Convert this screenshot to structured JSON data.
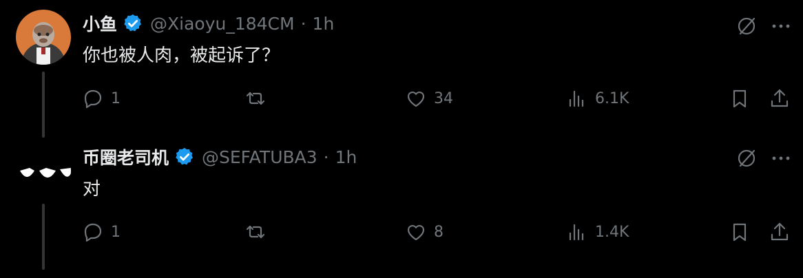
{
  "tweets": [
    {
      "display_name": "小鱼",
      "handle": "@Xiaoyu_184CM",
      "separator": "·",
      "time": "1h",
      "text": "你也被人肉，被起诉了？",
      "verified": true,
      "avatar_icon": "cartoon-character-avatar",
      "stats": {
        "replies": "1",
        "retweets": "",
        "likes": "34",
        "views": "6.1K"
      }
    },
    {
      "display_name": "币圈老司机",
      "handle": "@SEFATUBA3",
      "separator": "·",
      "time": "1h",
      "text": "对",
      "verified": true,
      "avatar_icon": "angry-eyes-avatar",
      "stats": {
        "replies": "1",
        "retweets": "",
        "likes": "8",
        "views": "1.4K"
      }
    }
  ],
  "colors": {
    "background": "#000000",
    "primary_text": "#e7e9ea",
    "secondary_text": "#71767b",
    "verified_badge": "#1d9bf0",
    "thread_line": "#333639"
  }
}
